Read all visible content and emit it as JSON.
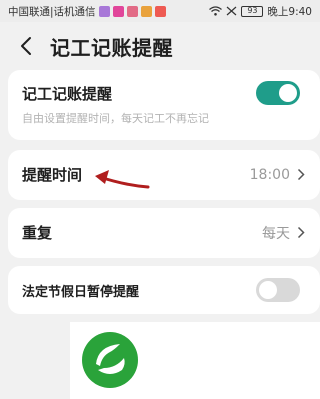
{
  "status_bar": {
    "carrier": "中国联通|话机通信",
    "time": "晚上9:40",
    "battery": "93",
    "app_icon_colors": [
      "#a878d8",
      "#e1459a",
      "#e26b86",
      "#e9a23c",
      "#ee5a52"
    ]
  },
  "header": {
    "title": "记工记账提醒",
    "back_icon": "chevron-left-icon"
  },
  "settings": {
    "reminder": {
      "title": "记工记账提醒",
      "subtitle": "自由设置提醒时间，每天记工不再忘记",
      "enabled": true
    },
    "remind_time": {
      "label": "提醒时间",
      "value": "18:00"
    },
    "repeat": {
      "label": "重复",
      "value": "每天"
    },
    "holiday_pause": {
      "label": "法定节假日暂停提醒",
      "enabled": false
    }
  },
  "colors": {
    "accent": "#1f9d8a",
    "arrow_annotation": "#b01e1e",
    "logo_green": "#2aa33a",
    "background": "#f1f1f1"
  },
  "annotation": {
    "arrow_icon": "red-arrow-pointer-icon"
  },
  "logo": {
    "icon": "green-leaf-logo-icon"
  }
}
